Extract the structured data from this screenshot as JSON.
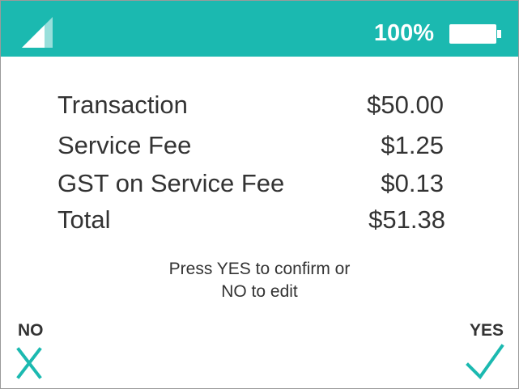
{
  "status": {
    "battery_text": "100%",
    "battery_level": 1.0,
    "accent_color": "#1bb9b0"
  },
  "summary": {
    "rows": [
      {
        "label": "Transaction",
        "value": "$50.00"
      },
      {
        "label": "Service Fee",
        "value": "$1.25"
      },
      {
        "label": "GST on Service Fee",
        "value": "$0.13"
      },
      {
        "label": "Total",
        "value": "$51.38"
      }
    ]
  },
  "prompt": {
    "line1": "Press YES to confirm or",
    "line2": "NO to edit"
  },
  "actions": {
    "no_label": "NO",
    "yes_label": "YES",
    "no_icon": "x-icon",
    "yes_icon": "checkmark-icon"
  }
}
